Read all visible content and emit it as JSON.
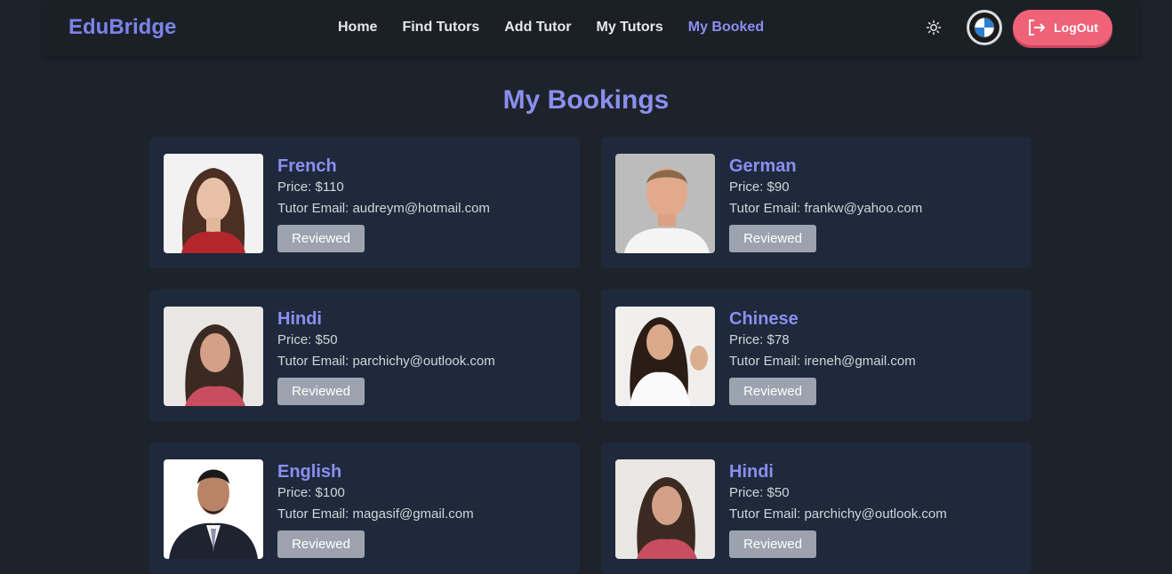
{
  "brand": "EduBridge",
  "nav": [
    {
      "label": "Home",
      "active": false
    },
    {
      "label": "Find Tutors",
      "active": false
    },
    {
      "label": "Add Tutor",
      "active": false
    },
    {
      "label": "My Tutors",
      "active": false
    },
    {
      "label": "My Booked",
      "active": true
    }
  ],
  "header": {
    "theme_icon": "sun-icon",
    "avatar_icon": "bmw-logo-avatar",
    "logout_icon": "logout-icon",
    "logout_label": "LogOut"
  },
  "page_title": "My Bookings",
  "bookings": [
    {
      "subject": "French",
      "price": "Price: $110",
      "email": "Tutor Email: audreym@hotmail.com",
      "status": "Reviewed"
    },
    {
      "subject": "German",
      "price": "Price: $90",
      "email": "Tutor Email: frankw@yahoo.com",
      "status": "Reviewed"
    },
    {
      "subject": "Hindi",
      "price": "Price: $50",
      "email": "Tutor Email: parchichy@outlook.com",
      "status": "Reviewed"
    },
    {
      "subject": "Chinese",
      "price": "Price: $78",
      "email": "Tutor Email: ireneh@gmail.com",
      "status": "Reviewed"
    },
    {
      "subject": "English",
      "price": "Price: $100",
      "email": "Tutor Email: magasif@gmail.com",
      "status": "Reviewed"
    },
    {
      "subject": "Hindi",
      "price": "Price: $50",
      "email": "Tutor Email: parchichy@outlook.com",
      "status": "Reviewed"
    }
  ],
  "colors": {
    "background": "#1d232a",
    "card": "#1e293b",
    "accent": "#8a8ff0",
    "logout": "#f06278",
    "status_button": "#9ca3af"
  }
}
